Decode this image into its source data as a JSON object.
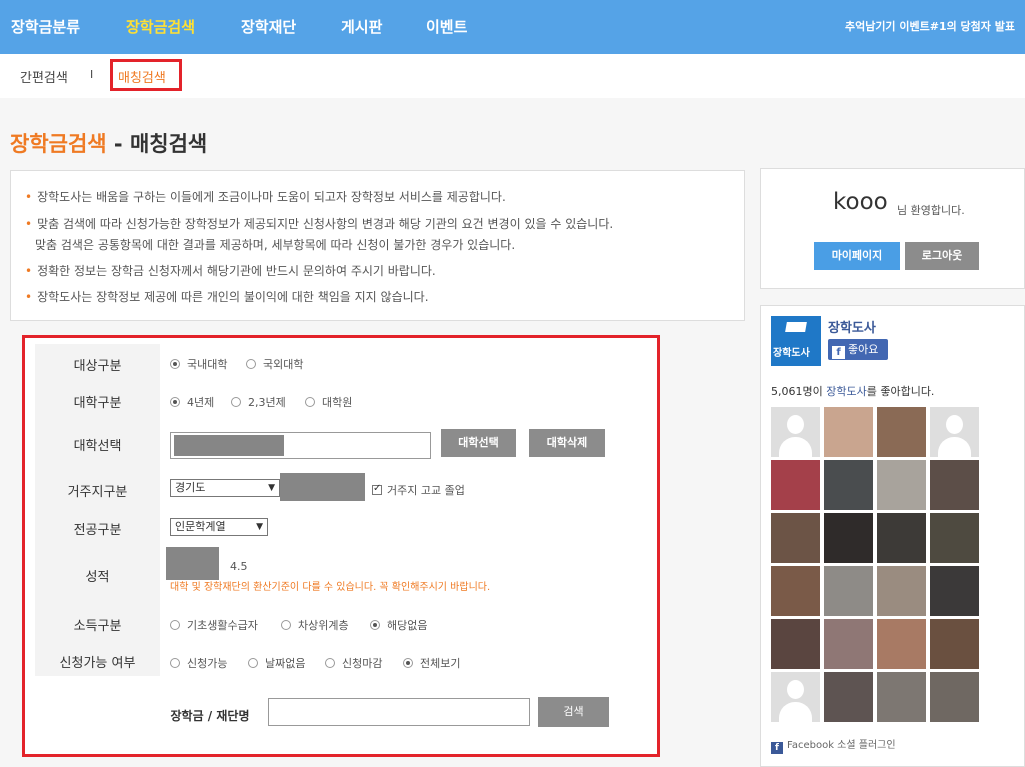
{
  "topnav": {
    "items": [
      "장학금분류",
      "장학금검색",
      "장학재단",
      "게시판",
      "이벤트"
    ],
    "active_index": 1,
    "notice": "추억남기기 이벤트#1의 당첨자 발표"
  },
  "subnav": {
    "simple": "간편검색",
    "separator": "I",
    "matching": "매칭검색"
  },
  "page_title": {
    "main": "장학금검색",
    "dash": " - ",
    "sub": "매칭검색"
  },
  "info_lines": [
    "장학도사는 배움을 구하는 이들에게 조금이나마 도움이 되고자 장학정보 서비스를 제공합니다.",
    "맞춤 검색에 따라 신청가능한 장학정보가 제공되지만 신청사항의 변경과 해당 기관의 요건 변경이 있을 수 있습니다.",
    "맞춤 검색은 공통항목에 대한 결과를 제공하며, 세부항목에 따라 신청이 불가한 경우가 있습니다.",
    "정확한 정보는 장학금 신청자께서 해당기관에 반드시 문의하여 주시기 바랍니다.",
    "장학도사는 장학정보 제공에 따른 개인의 불이익에 대한 책임을 지지 않습니다."
  ],
  "form": {
    "target_label": "대상구분",
    "target_options": [
      "국내대학",
      "국외대학"
    ],
    "univtype_label": "대학구분",
    "univtype_options": [
      "4년제",
      "2,3년제",
      "대학원"
    ],
    "univsel_label": "대학선택",
    "univsel_button": "대학선택",
    "univdel_button": "대학삭제",
    "region_label": "거주지구분",
    "region_value": "경기도",
    "region_check": "거주지 고교 졸업",
    "major_label": "전공구분",
    "major_value": "인문학계열",
    "grade_label": "성적",
    "grade_scale": "4.5",
    "grade_note": "대학 및 장학재단의 환산기준이 다를 수 있습니다. 꼭 확인해주시기 바랍니다.",
    "income_label": "소득구분",
    "income_options": [
      "기초생활수급자",
      "차상위계층",
      "해당없음"
    ],
    "apply_label": "신청가능 여부",
    "apply_options": [
      "신청가능",
      "날짜없음",
      "신청마감",
      "전체보기"
    ],
    "search_label": "장학금 / 재단명",
    "search_value": "",
    "search_button": "검색"
  },
  "login": {
    "username": "kooo",
    "welcome": "님 환영합니다.",
    "mypage_button": "마이페이지",
    "logout_button": "로그아웃"
  },
  "facebook": {
    "page_name": "장학도사",
    "logo_text": "장학도사",
    "like_button": "좋아요",
    "count": "5,061명이",
    "page_link": "장학도사",
    "count_suffix": "를 좋아합니다.",
    "plugin_text": "Facebook 소셜 플러그인"
  },
  "colors": {
    "nav_bg": "#55a3e7",
    "nav_active": "#ffe033",
    "accent_orange": "#ef7a23",
    "highlight_red": "#e3232a",
    "button_blue": "#4a9ee5",
    "button_gray": "#8c8c8c",
    "facebook_blue": "#4267b2"
  }
}
